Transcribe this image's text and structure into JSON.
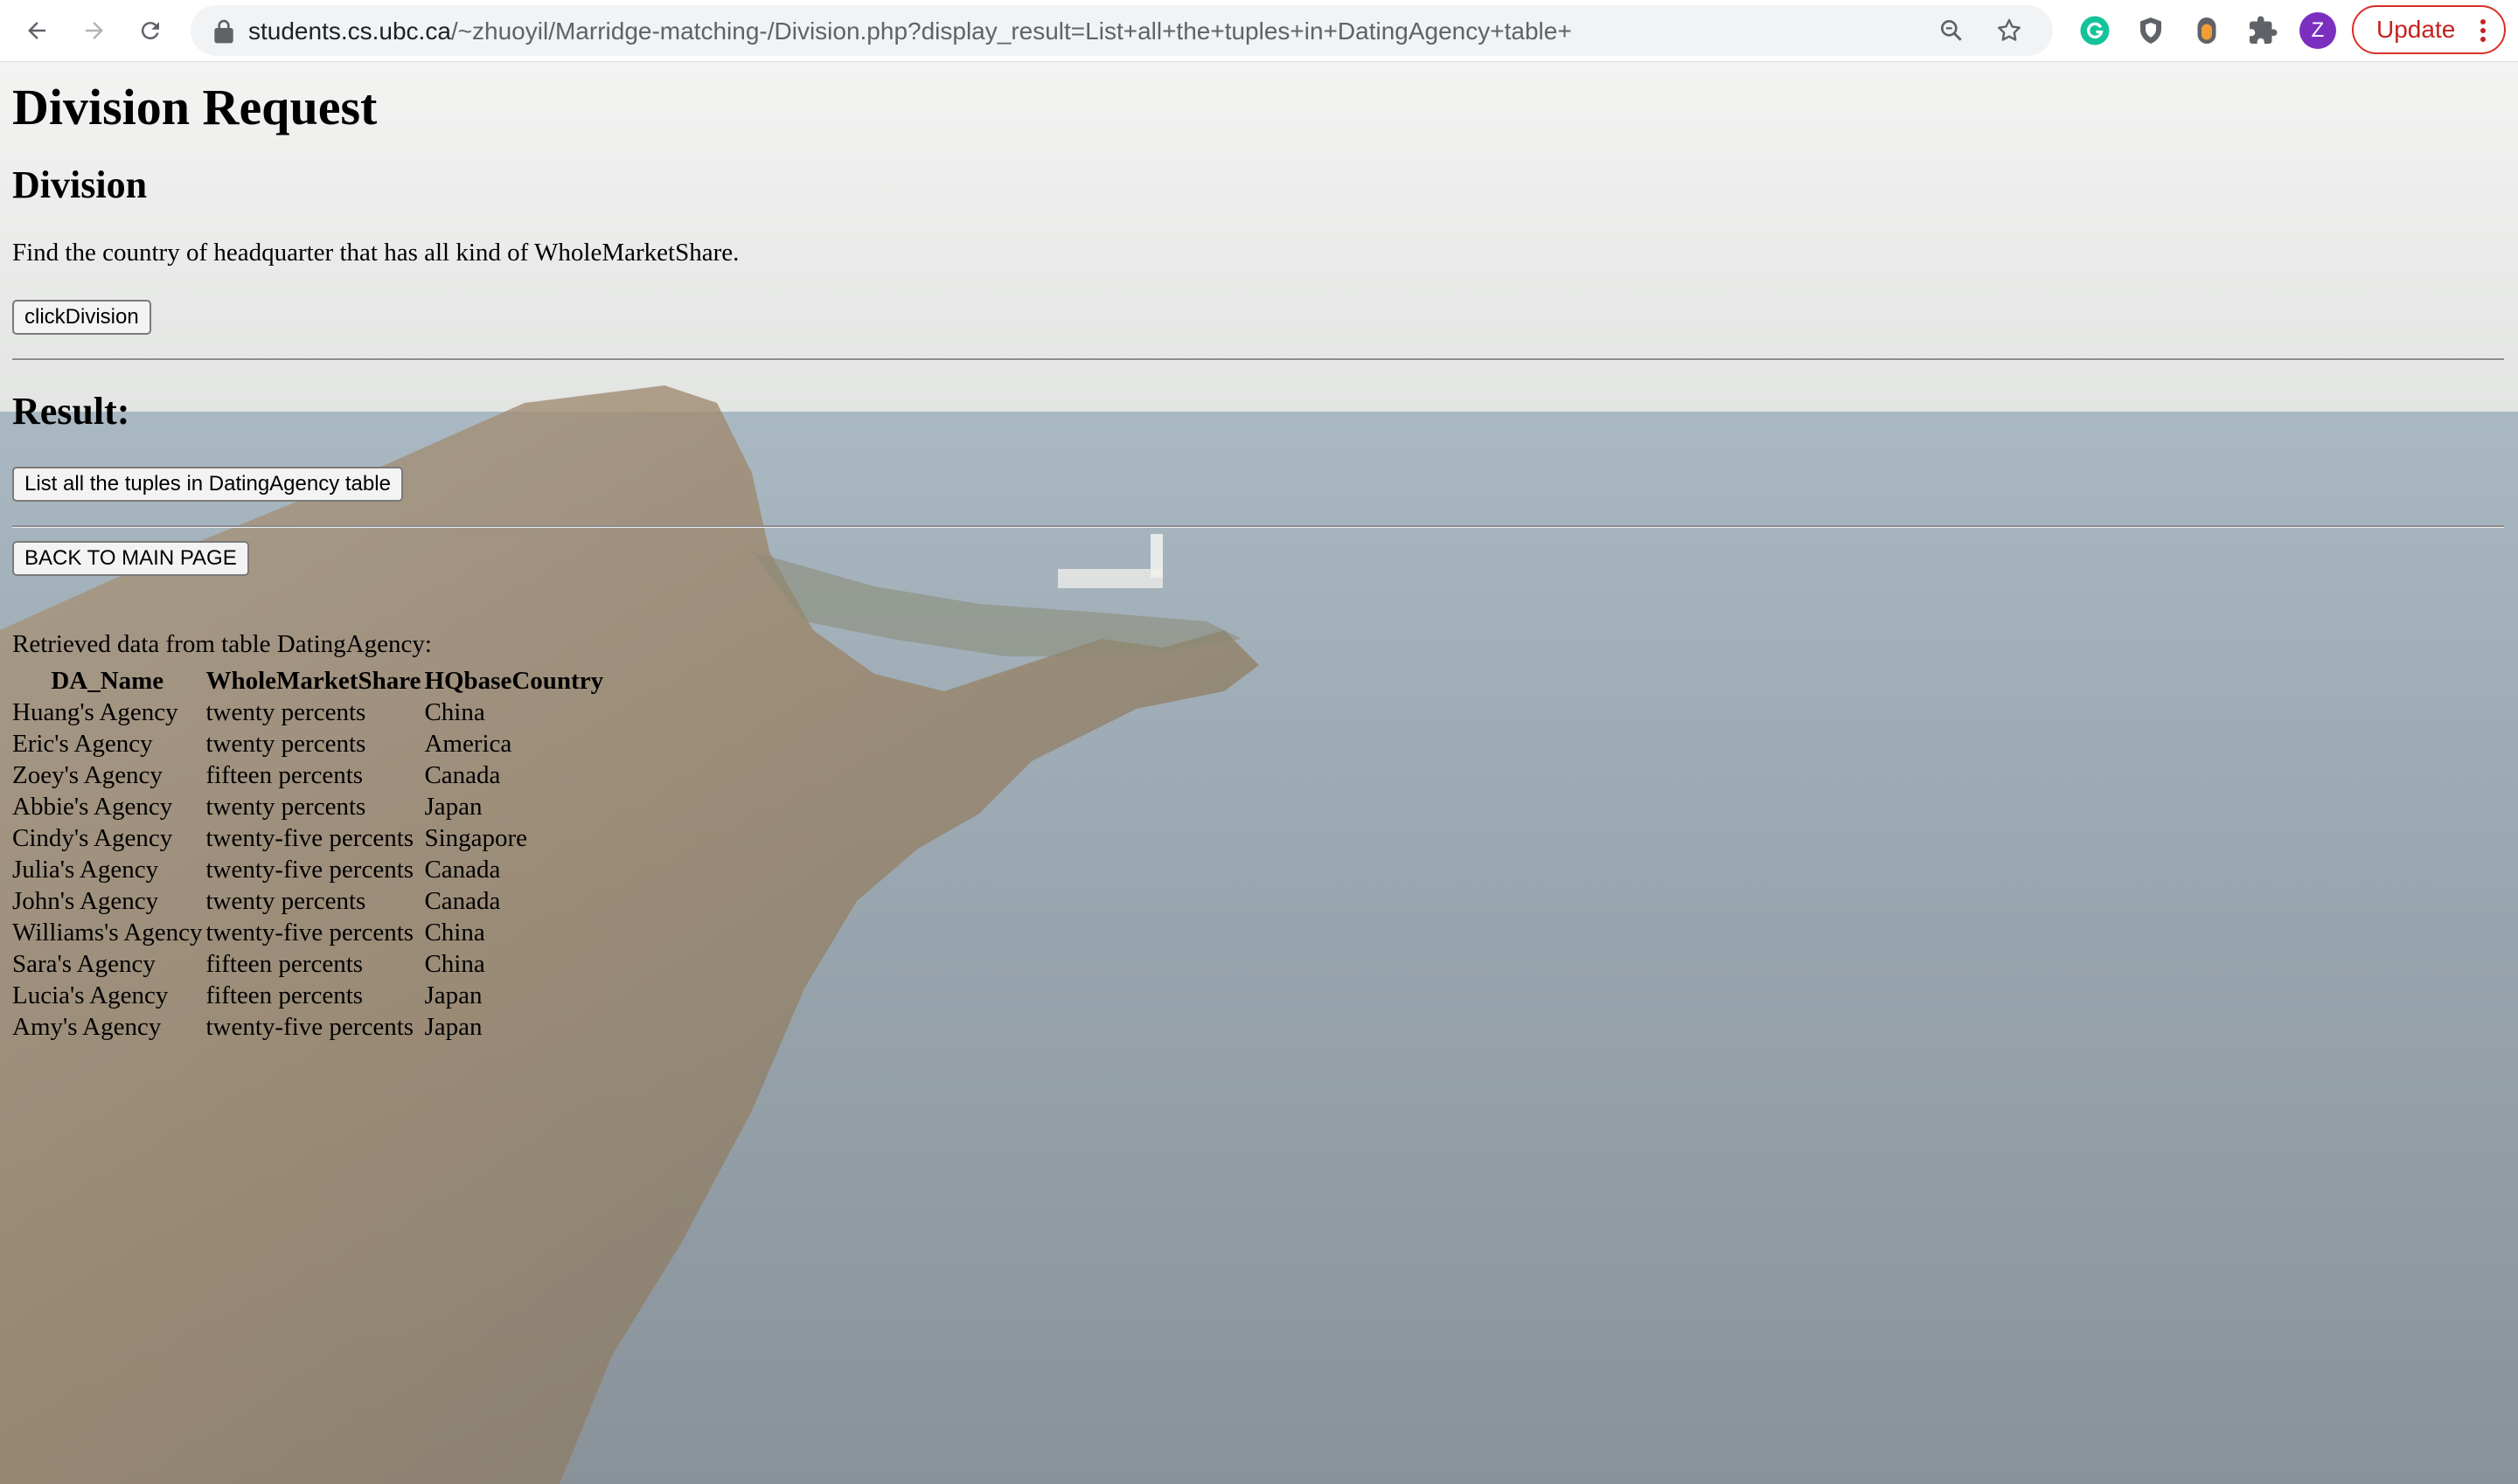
{
  "browser": {
    "url_host": "students.cs.ubc.ca",
    "url_path": "/~zhuoyil/Marridge-matching-/Division.php?display_result=List+all+the+tuples+in+DatingAgency+table+",
    "profile_initial": "Z",
    "update_label": "Update",
    "icons": [
      "back-arrow-icon",
      "forward-arrow-icon",
      "reload-icon",
      "lock-icon",
      "zoom-icon",
      "bookmark-star-icon",
      "grammarly-icon",
      "shield-extension-icon",
      "extension-badge-icon",
      "puzzle-extensions-icon",
      "kebab-menu-icon"
    ],
    "colors": {
      "profile": "#7b2fbf",
      "update": "#d93025",
      "grammarly": "#15c39a"
    }
  },
  "page": {
    "title": "Division Request",
    "division_heading": "Division",
    "division_description": "Find the country of headquarter that has all kind of WholeMarketShare.",
    "division_button": "clickDivision",
    "result_heading": "Result:",
    "list_button": "List all the tuples in DatingAgency table",
    "back_button": "BACK TO MAIN PAGE",
    "retrieved_text": "Retrieved data from table DatingAgency:"
  },
  "table": {
    "headers": [
      "DA_Name",
      "WholeMarketShare",
      "HQbaseCountry"
    ],
    "rows": [
      [
        "Huang's Agency",
        "twenty percents",
        "China"
      ],
      [
        "Eric's Agency",
        "twenty percents",
        "America"
      ],
      [
        "Zoey's Agency",
        "fifteen percents",
        "Canada"
      ],
      [
        "Abbie's Agency",
        "twenty percents",
        "Japan"
      ],
      [
        "Cindy's Agency",
        "twenty-five percents",
        "Singapore"
      ],
      [
        "Julia's Agency",
        "twenty-five percents",
        "Canada"
      ],
      [
        "John's Agency",
        "twenty percents",
        "Canada"
      ],
      [
        "Williams's Agency",
        "twenty-five percents",
        "China"
      ],
      [
        "Sara's Agency",
        "fifteen percents",
        "China"
      ],
      [
        "Lucia's Agency",
        "fifteen percents",
        "Japan"
      ],
      [
        "Amy's Agency",
        "twenty-five percents",
        "Japan"
      ]
    ]
  }
}
